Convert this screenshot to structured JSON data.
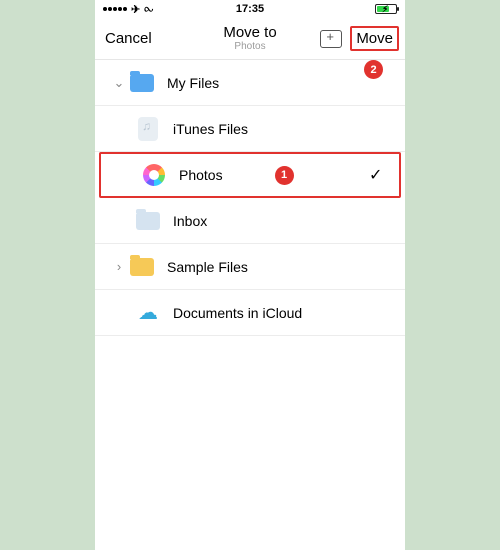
{
  "status": {
    "time": "17:35"
  },
  "nav": {
    "cancel": "Cancel",
    "title": "Move to",
    "subtitle": "Photos",
    "move": "Move"
  },
  "annotations": {
    "badge1": "1",
    "badge2": "2"
  },
  "rows": {
    "myfiles": "My Files",
    "itunes": "iTunes Files",
    "photos": "Photos",
    "inbox": "Inbox",
    "sample": "Sample Files",
    "icloud": "Documents in iCloud"
  },
  "checkmark": "✓"
}
